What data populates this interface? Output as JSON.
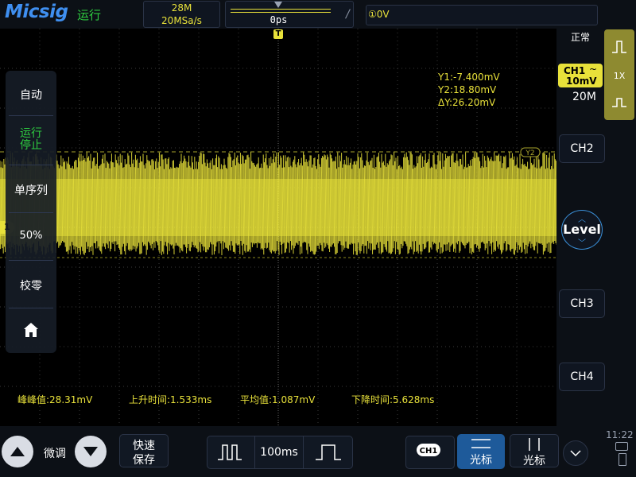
{
  "brand": {
    "logo": "Micsig",
    "run_status": "运行"
  },
  "acquisition": {
    "memory_depth": "28M",
    "sample_rate": "20MSa/s"
  },
  "timebase": {
    "delay": "0ps"
  },
  "trigger": {
    "level": "①0V",
    "edge_icon": "rising-edge-icon",
    "position_marker": "T"
  },
  "cursors": {
    "y1": "Y1:-7.400mV",
    "y2": "Y2:18.80mV",
    "dy": "ΔY:26.20mV",
    "y2_tag": "Y2"
  },
  "left_menu": {
    "auto": "自动",
    "run": "运行",
    "stop": "停止",
    "single": "单序列",
    "fifty": "50%",
    "zero": "校零",
    "home_icon": "home-icon"
  },
  "channel_marker": "1",
  "measurements": [
    {
      "label": "峰峰值:28.31mV"
    },
    {
      "label": "上升时间:1.533ms"
    },
    {
      "label": "平均值:1.087mV"
    },
    {
      "label": "下降时间:5.628ms"
    }
  ],
  "right_panel": {
    "mode": "正常",
    "ch1": {
      "name": "CH1",
      "coupling": "~",
      "scale": "10mV"
    },
    "bandwidth": "20M",
    "probe": "1X",
    "ch2": "CH2",
    "level": "Level",
    "ch3": "CH3",
    "ch4": "CH4"
  },
  "bottom": {
    "fine": "微调",
    "quick_save_1": "快速",
    "quick_save_2": "保存",
    "timebase": "100ms",
    "ch1_badge": "CH1",
    "cursor_h": "光标",
    "cursor_v": "光标",
    "clock": "11:22"
  },
  "colors": {
    "trace": "#e8e13a",
    "accent": "#3a8fd8",
    "run": "#2ecc40"
  }
}
